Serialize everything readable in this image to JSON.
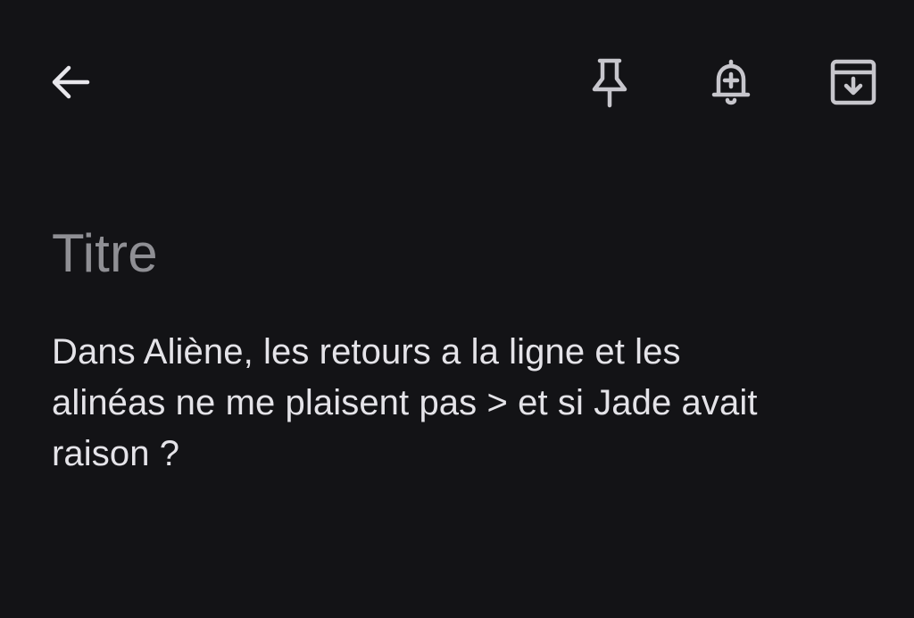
{
  "toolbar": {
    "back_icon": "arrow-left-icon",
    "pin_icon": "pin-icon",
    "reminder_icon": "bell-plus-icon",
    "archive_icon": "archive-icon",
    "icon_color": "#c7c6cc"
  },
  "note": {
    "title_placeholder": "Titre",
    "body": "Dans Aliène, les retours a la ligne et les\nalinéas ne me plaisent pas > et si Jade avait\nraison ?"
  },
  "colors": {
    "background": "#131316",
    "placeholder": "#8f8f94",
    "text": "#e4e3e8"
  }
}
